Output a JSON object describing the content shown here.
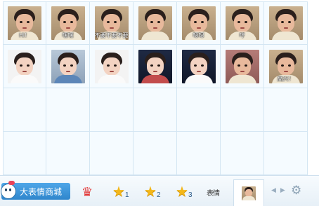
{
  "grid": {
    "rows": 4,
    "cols": 7,
    "stickers": [
      {
        "caption": "Hi！",
        "bg": "room",
        "face": "warm",
        "shirt": "cream"
      },
      {
        "caption": "嘿嘿",
        "bg": "room",
        "face": "warm",
        "shirt": "cream"
      },
      {
        "caption": "不要不要不要",
        "bg": "room",
        "face": "warm",
        "shirt": "cream"
      },
      {
        "caption": "",
        "bg": "room",
        "face": "warm",
        "shirt": "cream"
      },
      {
        "caption": "嗯嗯",
        "bg": "room",
        "face": "warm",
        "shirt": "cream"
      },
      {
        "caption": "哼",
        "bg": "room",
        "face": "warm",
        "shirt": "cream"
      },
      {
        "caption": "",
        "bg": "room",
        "face": "warm",
        "shirt": "cream"
      },
      {
        "caption": "",
        "bg": "white",
        "face": "pale",
        "shirt": "white"
      },
      {
        "caption": "",
        "bg": "sky",
        "face": "pale",
        "shirt": "blue"
      },
      {
        "caption": "",
        "bg": "white",
        "face": "pale",
        "shirt": "white"
      },
      {
        "caption": "",
        "bg": "dark",
        "face": "pale",
        "shirt": "red"
      },
      {
        "caption": "",
        "bg": "dark",
        "face": "pale",
        "shirt": "white"
      },
      {
        "caption": "",
        "bg": "mauve",
        "face": "warm",
        "shirt": "cream"
      },
      {
        "caption": "高兴！",
        "bg": "room",
        "face": "warm",
        "shirt": "cream"
      }
    ]
  },
  "toolbar": {
    "shop_label": "大表情商城",
    "star_labels": [
      "1",
      "2",
      "3"
    ],
    "small_label": "表情",
    "nav_prev": "◀",
    "nav_next": "▶",
    "settings_glyph": "⚙",
    "crown_glyph": "♛",
    "star_glyph": "★"
  },
  "colors": {
    "grid_line": "#d4e6f3",
    "grid_bg": "#f5fbff",
    "shop_button": "#3a94da",
    "star": "#f3b719"
  }
}
